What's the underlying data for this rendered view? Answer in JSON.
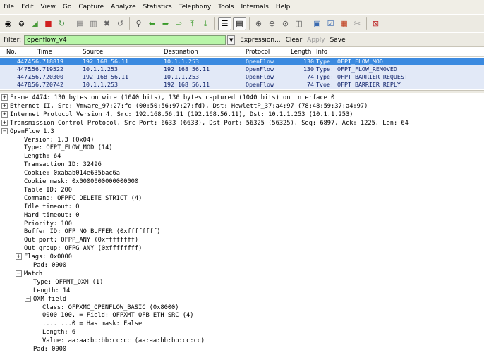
{
  "menu": [
    "File",
    "Edit",
    "View",
    "Go",
    "Capture",
    "Analyze",
    "Statistics",
    "Telephony",
    "Tools",
    "Internals",
    "Help"
  ],
  "toolbar_icons": [
    "interface-list-icon",
    "capture-options-icon",
    "start-capture-icon",
    "stop-capture-icon",
    "restart-capture-icon",
    "open-file-icon",
    "save-file-icon",
    "close-file-icon",
    "reload-icon",
    "find-icon",
    "go-back-icon",
    "go-forward-icon",
    "go-to-packet-icon",
    "go-first-icon",
    "go-last-icon",
    "colorize-icon",
    "autoscroll-icon",
    "zoom-in-icon",
    "zoom-out-icon",
    "zoom-normal-icon",
    "resize-columns-icon",
    "capture-filters-icon",
    "display-filters-icon",
    "coloring-rules-icon",
    "preferences-icon",
    "help-icon"
  ],
  "filter": {
    "label": "Filter:",
    "value": "openflow_v4",
    "expression": "Expression...",
    "clear": "Clear",
    "apply": "Apply",
    "save": "Save"
  },
  "columns": {
    "no": "No.",
    "time": "Time",
    "source": "Source",
    "destination": "Destination",
    "protocol": "Protocol",
    "length": "Length",
    "info": "Info"
  },
  "packets": [
    {
      "no": "4474",
      "time": "156.718819",
      "source": "192.168.56.11",
      "destination": "10.1.1.253",
      "protocol": "OpenFlow",
      "length": "130",
      "info": "Type: OFPT_FLOW_MOD",
      "selected": true
    },
    {
      "no": "4475",
      "time": "156.719522",
      "source": "10.1.1.253",
      "destination": "192.168.56.11",
      "protocol": "OpenFlow",
      "length": "130",
      "info": "Type: OFPT_FLOW_REMOVED",
      "selected": false
    },
    {
      "no": "4477",
      "time": "156.720300",
      "source": "192.168.56.11",
      "destination": "10.1.1.253",
      "protocol": "OpenFlow",
      "length": "74",
      "info": "Type: OFPT_BARRIER_REQUEST",
      "selected": false
    },
    {
      "no": "4478",
      "time": "156.720742",
      "source": "10.1.1.253",
      "destination": "192.168.56.11",
      "protocol": "OpenFlow",
      "length": "74",
      "info": "Tvoe: OFPT BARRIER REPLY",
      "selected": false
    }
  ],
  "details": [
    {
      "text": "Frame 4474: 130 bytes on wire (1040 bits), 130 bytes captured (1040 bits) on interface 0",
      "toggle": "+",
      "level": 0
    },
    {
      "text": "Ethernet II, Src: Vmware_97:27:fd (00:50:56:97:27:fd), Dst: HewlettP_37:a4:97 (78:48:59:37:a4:97)",
      "toggle": "+",
      "level": 0
    },
    {
      "text": "Internet Protocol Version 4, Src: 192.168.56.11 (192.168.56.11), Dst: 10.1.1.253 (10.1.1.253)",
      "toggle": "+",
      "level": 0
    },
    {
      "text": "Transmission Control Protocol, Src Port: 6633 (6633), Dst Port: 56325 (56325), Seq: 6897, Ack: 1225, Len: 64",
      "toggle": "+",
      "level": 0
    },
    {
      "text": "OpenFlow 1.3",
      "toggle": "-",
      "level": 0
    },
    {
      "text": "Version: 1.3 (0x04)",
      "toggle": "",
      "level": 1
    },
    {
      "text": "Type: OFPT_FLOW_MOD (14)",
      "toggle": "",
      "level": 1
    },
    {
      "text": "Length: 64",
      "toggle": "",
      "level": 1
    },
    {
      "text": "Transaction ID: 32496",
      "toggle": "",
      "level": 1
    },
    {
      "text": "Cookie: 0xabab014e635bac6a",
      "toggle": "",
      "level": 1
    },
    {
      "text": "Cookie mask: 0x0000000000000000",
      "toggle": "",
      "level": 1
    },
    {
      "text": "Table ID: 200",
      "toggle": "",
      "level": 1
    },
    {
      "text": "Command: OFPFC_DELETE_STRICT (4)",
      "toggle": "",
      "level": 1
    },
    {
      "text": "Idle timeout: 0",
      "toggle": "",
      "level": 1
    },
    {
      "text": "Hard timeout: 0",
      "toggle": "",
      "level": 1
    },
    {
      "text": "Priority: 100",
      "toggle": "",
      "level": 1
    },
    {
      "text": "Buffer ID: OFP_NO_BUFFER (0xffffffff)",
      "toggle": "",
      "level": 1
    },
    {
      "text": "Out port: OFPP_ANY (0xffffffff)",
      "toggle": "",
      "level": 1
    },
    {
      "text": "Out group: OFPG_ANY (0xffffffff)",
      "toggle": "",
      "level": 1
    },
    {
      "text": "Flags: 0x0000",
      "toggle": "+",
      "level": 1
    },
    {
      "text": "Pad: 0000",
      "toggle": "",
      "level": 2
    },
    {
      "text": "Match",
      "toggle": "-",
      "level": 1
    },
    {
      "text": "Type: OFPMT_OXM (1)",
      "toggle": "",
      "level": 2
    },
    {
      "text": "Length: 14",
      "toggle": "",
      "level": 2
    },
    {
      "text": "OXM field",
      "toggle": "-",
      "level": 2
    },
    {
      "text": "Class: OFPXMC_OPENFLOW_BASIC (0x8000)",
      "toggle": "",
      "level": 3
    },
    {
      "text": "0000 100. = Field: OFPXMT_OFB_ETH_SRC (4)",
      "toggle": "",
      "level": 3
    },
    {
      "text": ".... ...0 = Has mask: False",
      "toggle": "",
      "level": 3
    },
    {
      "text": "Length: 6",
      "toggle": "",
      "level": 3
    },
    {
      "text": "Value: aa:aa:bb:bb:cc:cc (aa:aa:bb:bb:cc:cc)",
      "toggle": "",
      "level": 3
    },
    {
      "text": "Pad: 0000",
      "toggle": "",
      "level": 2
    }
  ]
}
